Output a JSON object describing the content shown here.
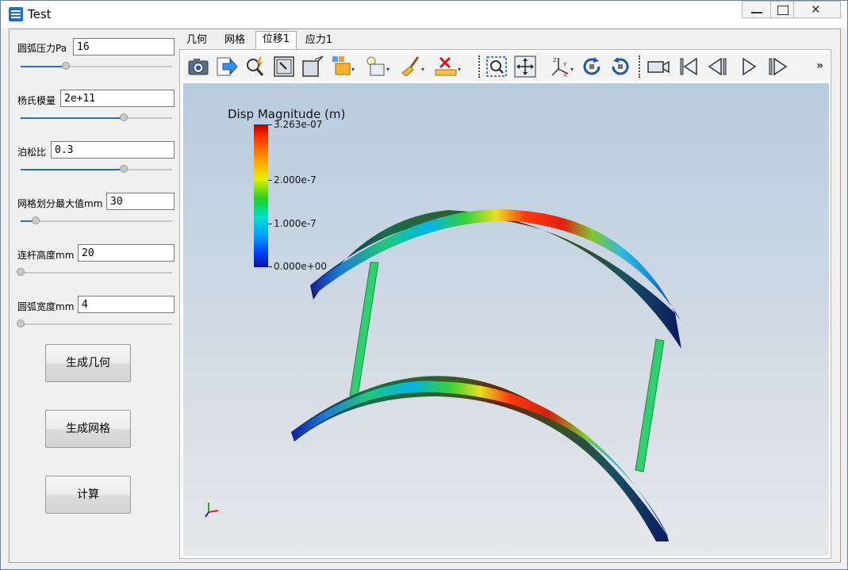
{
  "window": {
    "title": "Test"
  },
  "params": [
    {
      "label": "圆弧压力Pa",
      "value": "16",
      "slider_fraction": 0.3
    },
    {
      "label": "杨氏模量",
      "value": "2e+11",
      "slider_fraction": 0.68
    },
    {
      "label": "泊松比",
      "value": "0.3",
      "slider_fraction": 0.68
    },
    {
      "label": "网格划分最大值mm",
      "value": "30",
      "slider_fraction": 0.1
    },
    {
      "label": "连杆高度mm",
      "value": "20",
      "slider_fraction": 0.0
    },
    {
      "label": "圆弧宽度mm",
      "value": "4",
      "slider_fraction": 0.0
    }
  ],
  "buttons": {
    "generate_geometry": "生成几何",
    "generate_mesh": "生成网格",
    "compute": "计算"
  },
  "tabs": [
    {
      "label": "几何",
      "active": false
    },
    {
      "label": "网格",
      "active": false
    },
    {
      "label": "位移1",
      "active": true
    },
    {
      "label": "应力1",
      "active": false
    }
  ],
  "toolbar": {
    "icons": [
      "camera-icon",
      "export-icon",
      "zoom-to-fit-icon",
      "view-frame-icon",
      "view-box-icon",
      "display-mode-icon",
      "display-style-icon",
      "broom-icon",
      "delete-measure-icon",
      "zoom-box-icon",
      "pan-icon",
      "axis-orientation-icon",
      "rotate-cw-icon",
      "rotate-ccw-icon",
      "record-icon",
      "first-frame-icon",
      "previous-frame-icon",
      "play-icon",
      "next-frame-icon"
    ],
    "more": "»"
  },
  "legend": {
    "title": "Disp Magnitude (m)",
    "labels": [
      "3.263e-07",
      "2.000e-7",
      "1.000e-7",
      "0.000e+00"
    ],
    "colors": [
      "#b30000",
      "#ff2a00",
      "#ffa000",
      "#e6f000",
      "#20d020",
      "#00e0d0",
      "#00a0ff",
      "#0040ff",
      "#1010a0"
    ]
  }
}
